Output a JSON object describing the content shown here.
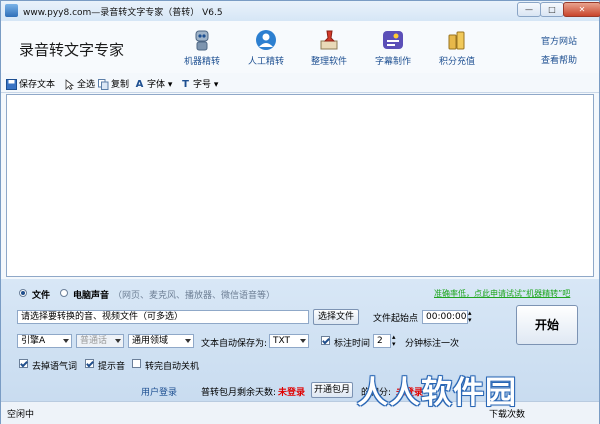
{
  "window": {
    "title": "www.pyy8.com—录音转文字专家（普转） V6.5",
    "controls": {
      "minimize": "—",
      "maximize": "□",
      "close": "✕"
    }
  },
  "header": {
    "app_name": "录音转文字专家",
    "nav": [
      {
        "label": "机器精转",
        "icon": "robot-icon"
      },
      {
        "label": "人工精转",
        "icon": "person-icon"
      },
      {
        "label": "整理软件",
        "icon": "pushpin-icon"
      },
      {
        "label": "字幕制作",
        "icon": "subtitle-icon"
      },
      {
        "label": "积分充值",
        "icon": "coins-icon"
      }
    ],
    "links": {
      "official_site": "官方网站",
      "help": "查看帮助"
    }
  },
  "toolbar": {
    "save_text": "保存文本",
    "select_all": "全选",
    "copy": "复制",
    "font": "字体",
    "font_size": "字号"
  },
  "source": {
    "file_label": "文件",
    "computer_audio_label": "电脑声音",
    "computer_audio_hint": "（网页、麦克风、播放器、微信语音等）",
    "selected": "file",
    "promo_link": "准确率低，点此申请试试“机器精转”吧"
  },
  "file_input": {
    "value": "请选择要转换的音、视频文件（可多选）",
    "select_button": "选择文件",
    "start_point_label": "文件起始点",
    "start_point_value": "00:00:00"
  },
  "options": {
    "engine": "引擎A",
    "language": "普通话",
    "domain": "通用领域",
    "autosave_label": "文本自动保存为:",
    "autosave_format": "TXT",
    "mark_time_label": "标注时间",
    "mark_time_checked": true,
    "interval_value": "2",
    "interval_label": "分钟标注一次",
    "remove_fillers_label": "去掉语气词",
    "remove_fillers_checked": true,
    "beep_label": "提示音",
    "beep_checked": true,
    "shutdown_label": "转完自动关机",
    "shutdown_checked": false,
    "start_button": "开始"
  },
  "account": {
    "login_link": "用户登录",
    "remaining_label": "普转包月剩余天数:",
    "remaining_value": "未登录",
    "monthly_button": "开通包月",
    "points_label": "的积分:",
    "points_value": "未登录"
  },
  "statusbar": {
    "status": "空闲中",
    "right_text": "下载次数"
  },
  "watermark": "人人软件园",
  "colors": {
    "accent": "#1d4f91",
    "red": "#e00000",
    "green": "#1ea51e"
  }
}
